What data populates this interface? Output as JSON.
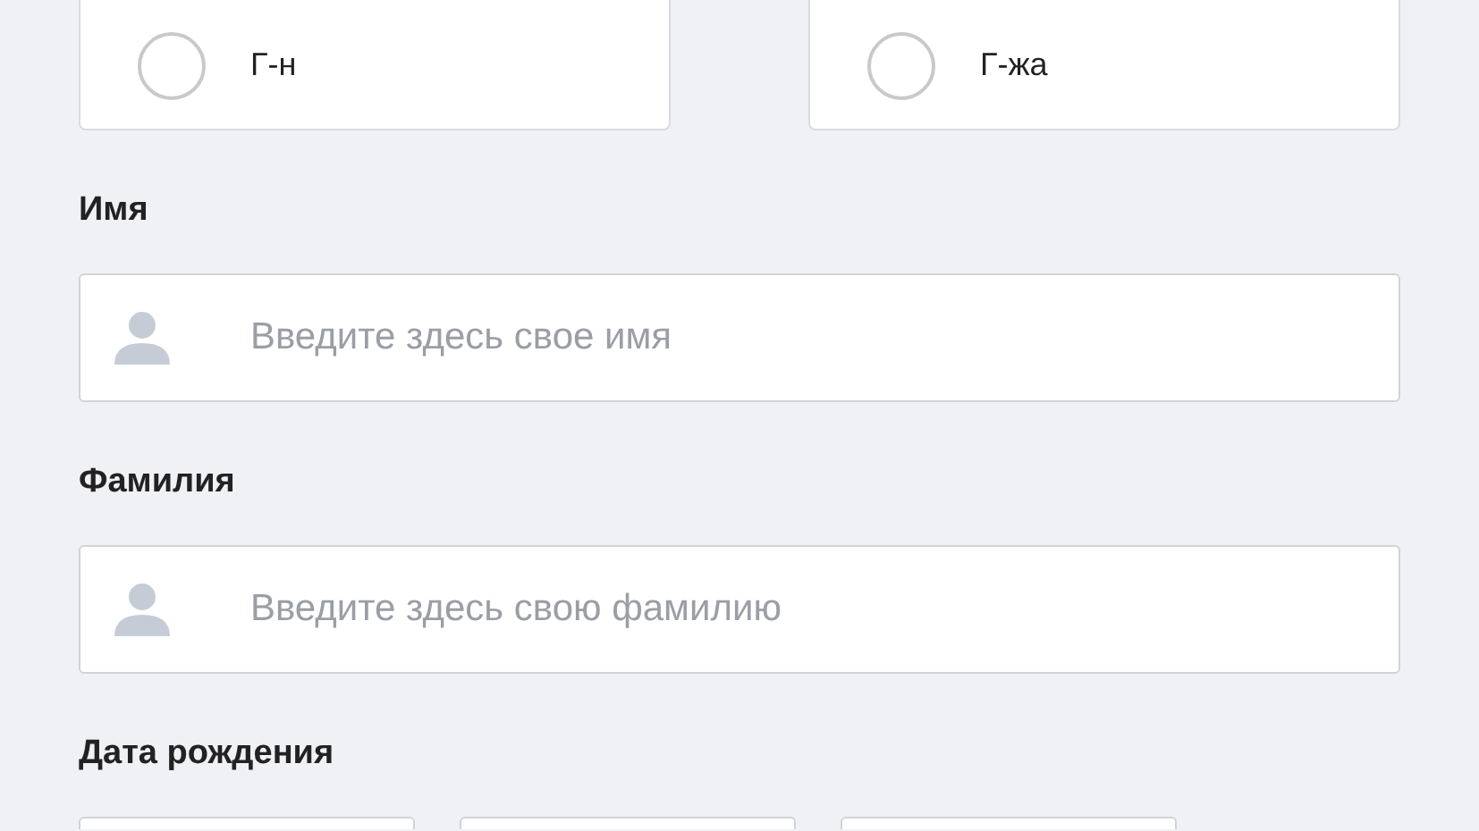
{
  "title_options": [
    {
      "label": "Г-н",
      "selected": false
    },
    {
      "label": "Г-жа",
      "selected": false
    }
  ],
  "fields": [
    {
      "label": "Имя",
      "placeholder": "Введите здесь свое имя"
    },
    {
      "label": "Фамилия",
      "placeholder": "Введите здесь свою фамилию"
    }
  ],
  "birth_date": {
    "label": "Дата рождения",
    "parts": [
      {
        "kind": "box"
      },
      {
        "kind": "box"
      },
      {
        "kind": "box"
      }
    ]
  }
}
